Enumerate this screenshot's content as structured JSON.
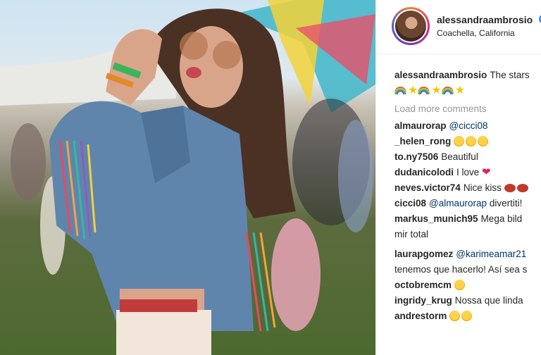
{
  "post": {
    "username": "alessandraambrosio",
    "location": "Coachella, California",
    "caption": "The stars"
  },
  "comments_section": {
    "load_more": "Load more comments",
    "items": [
      {
        "user": "almaurorap",
        "text": "@cicci08"
      },
      {
        "user": "_helen_rong",
        "text": ""
      },
      {
        "user": "to.ny7506",
        "text": "Beautiful"
      },
      {
        "user": "dudanicolodi",
        "text": "I love"
      },
      {
        "user": "neves.victor74",
        "text": "Nice kiss"
      },
      {
        "user": "cicci08",
        "mention": "@almaurorap",
        "text": "divertiti!"
      },
      {
        "user": "markus_munich95",
        "text": "Mega bild"
      },
      {
        "user": "",
        "text": "mir total"
      },
      {
        "user": "laurapgomez",
        "mention": "@karimeamar21",
        "text": ""
      },
      {
        "user": "",
        "text": "tenemos que hacerlo! Así sea s"
      },
      {
        "user": "octobremcm",
        "text": ""
      },
      {
        "user": "ingridy_krug",
        "text": "Nossa que linda"
      },
      {
        "user": "andrestorm",
        "text": ""
      }
    ]
  },
  "colors": {
    "username": "#262626",
    "mention": "#003569",
    "muted": "#999999",
    "verified": "#3897f0"
  },
  "icons": [
    "verified-badge-icon",
    "rainbow-emoji",
    "star-emoji",
    "heart-eyes-emoji",
    "red-heart-emoji",
    "kiss-lips-emoji",
    "smiling-emoji"
  ]
}
